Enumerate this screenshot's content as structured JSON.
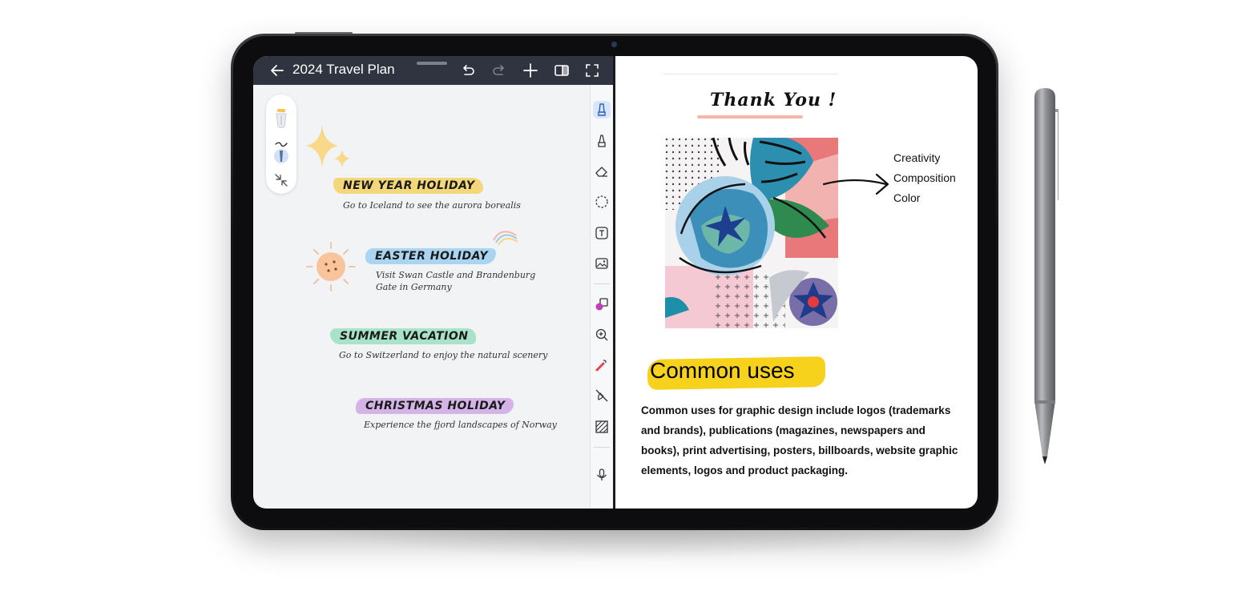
{
  "note_app": {
    "title": "2024 Travel Plan",
    "icons": [
      "back-arrow-icon",
      "undo-icon",
      "redo-icon",
      "add-icon",
      "split-view-icon",
      "fullscreen-icon"
    ]
  },
  "toolbar": {
    "tools": [
      "pen-icon",
      "highlighter-icon",
      "eraser-icon",
      "lasso-icon",
      "text-box-icon",
      "image-icon",
      "shapes-icon",
      "zoom-icon",
      "laser-pointer-icon",
      "hand-write-off-icon",
      "pattern-icon",
      "microphone-icon"
    ]
  },
  "entries": [
    {
      "title": "NEW YEAR HOLIDAY",
      "desc": "Go to Iceland to see the aurora borealis",
      "color": "#f4d77a"
    },
    {
      "title": "EASTER HOLIDAY",
      "desc": "Visit Swan Castle and Brandenburg Gate in Germany",
      "color": "#a9d4f2"
    },
    {
      "title": "SUMMER VACATION",
      "desc": "Go to Switzerland to enjoy the natural scenery",
      "color": "#a8e2c9"
    },
    {
      "title": "CHRISTMAS HOLIDAY",
      "desc": "Experience the fjord landscapes of Norway",
      "color": "#d4b3e6"
    }
  ],
  "design_page": {
    "thank_you": "Thank You !",
    "tags": [
      "Creativity",
      "Composition",
      "Color"
    ],
    "heading": "Common uses",
    "body": "Common uses for graphic design include logos (trademarks and brands), publications (magazines, newspapers and books), print advertising, posters, billboards, website graphic elements, logos and product packaging.",
    "highlight_color": "#f7d21c"
  }
}
